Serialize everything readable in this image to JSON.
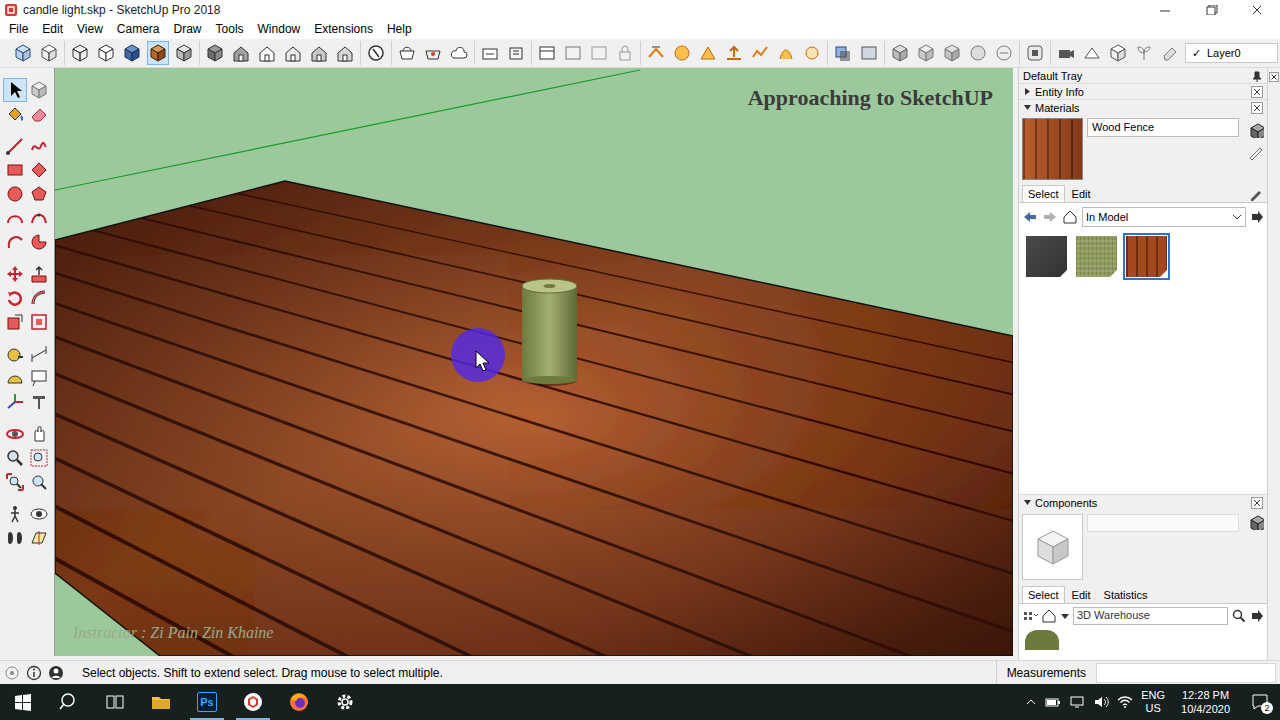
{
  "window": {
    "title": "candle light.skp - SketchUp Pro 2018"
  },
  "menu": [
    "File",
    "Edit",
    "View",
    "Camera",
    "Draw",
    "Tools",
    "Window",
    "Extensions",
    "Help"
  ],
  "face_styles": [
    {
      "selected": false
    },
    {
      "selected": false
    },
    {
      "selected": false
    },
    {
      "selected": false
    },
    {
      "selected": false
    },
    {
      "selected": true
    },
    {
      "selected": false
    }
  ],
  "layer": {
    "check": "✓",
    "name": "Layer0"
  },
  "left_toolbar": [
    {
      "selected": true
    },
    {
      "selected": false
    },
    {
      "selected": false
    },
    {
      "selected": false
    },
    {
      "selected": false
    },
    {
      "selected": false
    },
    {
      "selected": false
    },
    {
      "selected": false
    },
    {
      "selected": false
    },
    {
      "selected": false
    },
    {
      "selected": false
    },
    {
      "selected": false
    },
    {
      "selected": false
    },
    {
      "selected": false
    },
    {
      "selected": false
    },
    {
      "selected": false
    },
    {
      "selected": false
    },
    {
      "selected": false
    },
    {
      "selected": false
    },
    {
      "selected": false
    },
    {
      "selected": false
    },
    {
      "selected": false
    },
    {
      "selected": false
    },
    {
      "selected": false
    },
    {
      "selected": false
    },
    {
      "selected": false
    },
    {
      "selected": false
    },
    {
      "selected": false
    },
    {
      "selected": false
    },
    {
      "selected": false
    },
    {
      "selected": false
    },
    {
      "selected": false
    },
    {
      "selected": false
    },
    {
      "selected": false
    },
    {
      "selected": false
    },
    {
      "selected": false
    }
  ],
  "viewport": {
    "caption": "Approaching to SketchUP",
    "watermark": "Instructor : Zi Pain Zin Khaine"
  },
  "tray": {
    "title": "Default Tray",
    "entity_info": {
      "label": "Entity Info",
      "expanded": false
    },
    "materials": {
      "label": "Materials",
      "expanded": true,
      "name": "Wood Fence",
      "tabs": [
        {
          "label": "Select",
          "selected": true
        },
        {
          "label": "Edit",
          "selected": false
        }
      ],
      "collection": "In Model",
      "swatches": [
        {
          "color": "#3b3b3b",
          "selected": false
        },
        {
          "color": "#8d9a5c",
          "selected": false
        },
        {
          "color": "#a4481f",
          "selected": true
        }
      ]
    },
    "components": {
      "label": "Components",
      "expanded": true,
      "tabs": [
        {
          "label": "Select",
          "selected": true
        },
        {
          "label": "Edit",
          "selected": false
        },
        {
          "label": "Statistics",
          "selected": false
        }
      ],
      "search": "3D Warehouse"
    }
  },
  "status_bar": {
    "message": "Select objects. Shift to extend select. Drag mouse to select multiple.",
    "measurements_label": "Measurements"
  },
  "taskbar": {
    "photoshop_label": "Ps",
    "language": "ENG",
    "region": "US",
    "time": "12:28 PM",
    "date": "10/4/2020",
    "notifications": "2"
  }
}
